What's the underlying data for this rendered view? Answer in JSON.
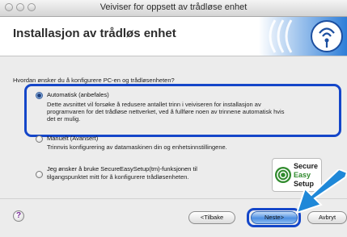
{
  "window": {
    "title": "Veiviser for oppsett av trådløse enhet"
  },
  "header": {
    "title": "Installasjon av trådløs enhet"
  },
  "main": {
    "question": "Hvordan ønsker du å konfigurere PC-en og trådløsenheten?",
    "options": [
      {
        "label": "Automatisk (anbefales)",
        "selected": true,
        "description_lines": [
          "Dette avsnittet vil forsøke å redusere antallet trinn i veiviseren for installasjon av",
          "programvaren for det trådløse nettverket, ved å fullføre noen av trinnene automatisk hvis",
          "det er mulig."
        ]
      },
      {
        "label": "Manuelt (Avansert)",
        "selected": false,
        "description_lines": [
          "Trinnvis konfigurering av datamaskinen din og enhetsinnstillingene."
        ]
      },
      {
        "label": "Jeg ønsker å bruke SecureEasySetup(tm)-funksjonen til",
        "selected": false,
        "description_lines": [
          "tilgangspunktet mitt for å konfigurere trådløsenheten."
        ]
      }
    ],
    "secure_badge": {
      "line1": "Secure",
      "line2": "Easy",
      "line3": "Setup"
    }
  },
  "footer": {
    "help": "?",
    "back": "<Tilbake",
    "next": "Neste>",
    "cancel": "Avbryt"
  },
  "colors": {
    "highlight": "#1446c9",
    "arrow": "#1f88d8",
    "badge_green": "#2f8a2c"
  }
}
